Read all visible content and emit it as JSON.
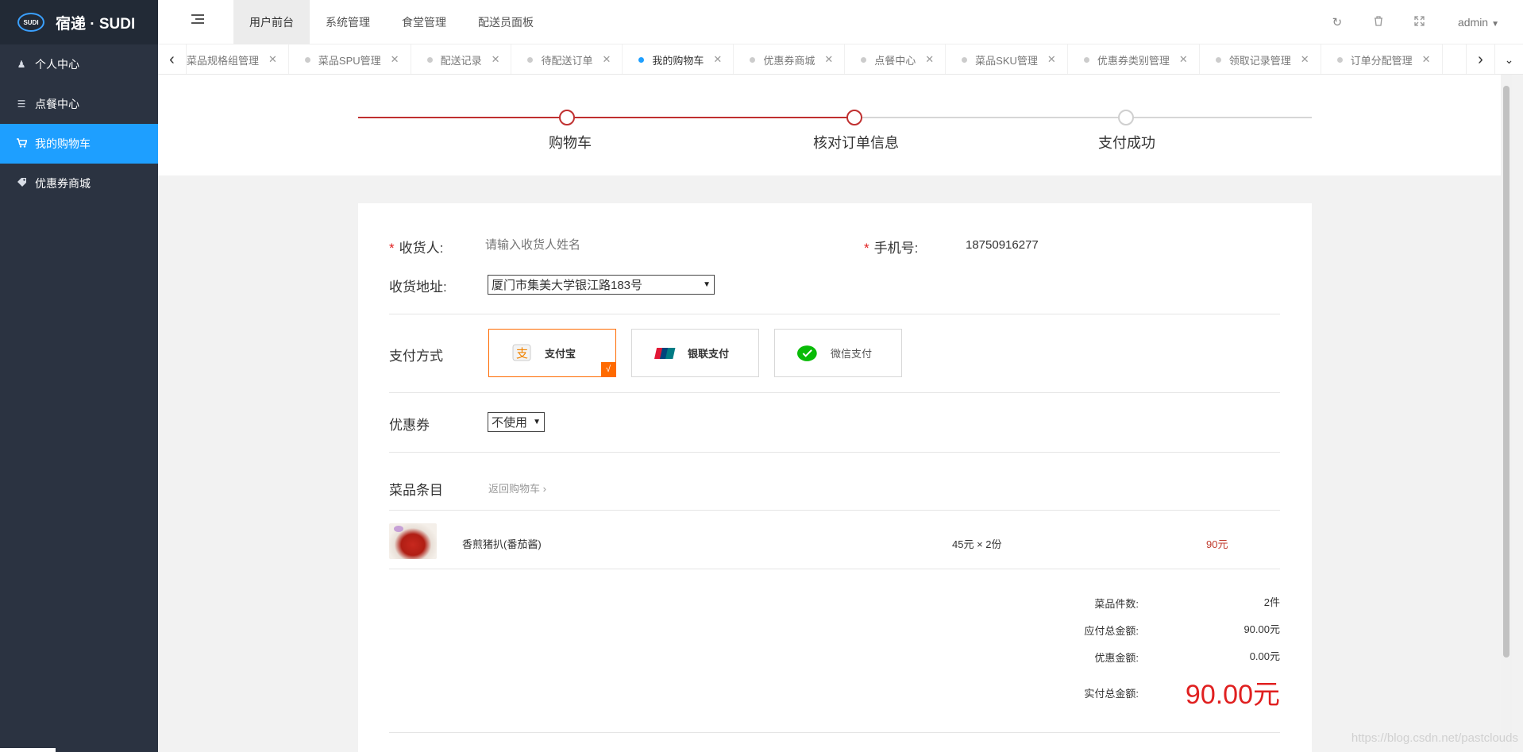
{
  "app": {
    "logo_badge": "SUDI",
    "title": "宿递 · SUDI"
  },
  "sidebar": {
    "items": [
      {
        "label": "个人中心",
        "icon": "user-icon"
      },
      {
        "label": "点餐中心",
        "icon": "list-icon"
      },
      {
        "label": "我的购物车",
        "icon": "cart-icon",
        "active": true
      },
      {
        "label": "优惠券商城",
        "icon": "tag-icon"
      }
    ]
  },
  "header": {
    "nav": [
      "用户前台",
      "系统管理",
      "食堂管理",
      "配送员面板"
    ],
    "active_nav": "用户前台",
    "user": "admin"
  },
  "tabs": [
    {
      "label": "菜品规格组管理"
    },
    {
      "label": "菜品SPU管理"
    },
    {
      "label": "配送记录"
    },
    {
      "label": "待配送订单"
    },
    {
      "label": "我的购物车",
      "active": true
    },
    {
      "label": "优惠券商城"
    },
    {
      "label": "点餐中心"
    },
    {
      "label": "菜品SKU管理"
    },
    {
      "label": "优惠券类别管理"
    },
    {
      "label": "领取记录管理"
    },
    {
      "label": "订单分配管理"
    }
  ],
  "steps": {
    "items": [
      "购物车",
      "核对订单信息",
      "支付成功"
    ],
    "current": 2
  },
  "form": {
    "receiver_label": "收货人:",
    "receiver_placeholder": "请输入收货人姓名",
    "phone_label": "手机号:",
    "phone_value": "18750916277",
    "address_label": "收货地址:",
    "address_value": "厦门市集美大学银江路183号",
    "payment_label": "支付方式",
    "payment_methods": [
      {
        "label": "支付宝",
        "icon": "alipay-icon",
        "selected": true
      },
      {
        "label": "银联支付",
        "icon": "unionpay-icon"
      },
      {
        "label": "微信支付",
        "icon": "wechat-pay-icon"
      }
    ],
    "payment_check": "√",
    "coupon_label": "优惠券",
    "coupon_value": "不使用",
    "items_label": "菜品条目",
    "back_to_cart": "返回购物车"
  },
  "order_items": [
    {
      "name": "香煎猪扒(番茄酱)",
      "qty_text": "45元  ×  2份",
      "subtotal": "90元"
    }
  ],
  "summary": {
    "count_label": "菜品件数:",
    "count_value": "2件",
    "payable_label": "应付总金额:",
    "payable_value": "90.00元",
    "discount_label": "优惠金额:",
    "discount_value": "0.00元",
    "actual_label": "实付总金额:",
    "actual_value": "90.00元"
  },
  "watermark": "https://blog.csdn.net/pastclouds",
  "colors": {
    "sidebar_bg": "#2b3341",
    "active_blue": "#1e9fff",
    "step_red": "#c03030",
    "price_red": "#e02020",
    "pay_selected": "#ff6a00"
  }
}
